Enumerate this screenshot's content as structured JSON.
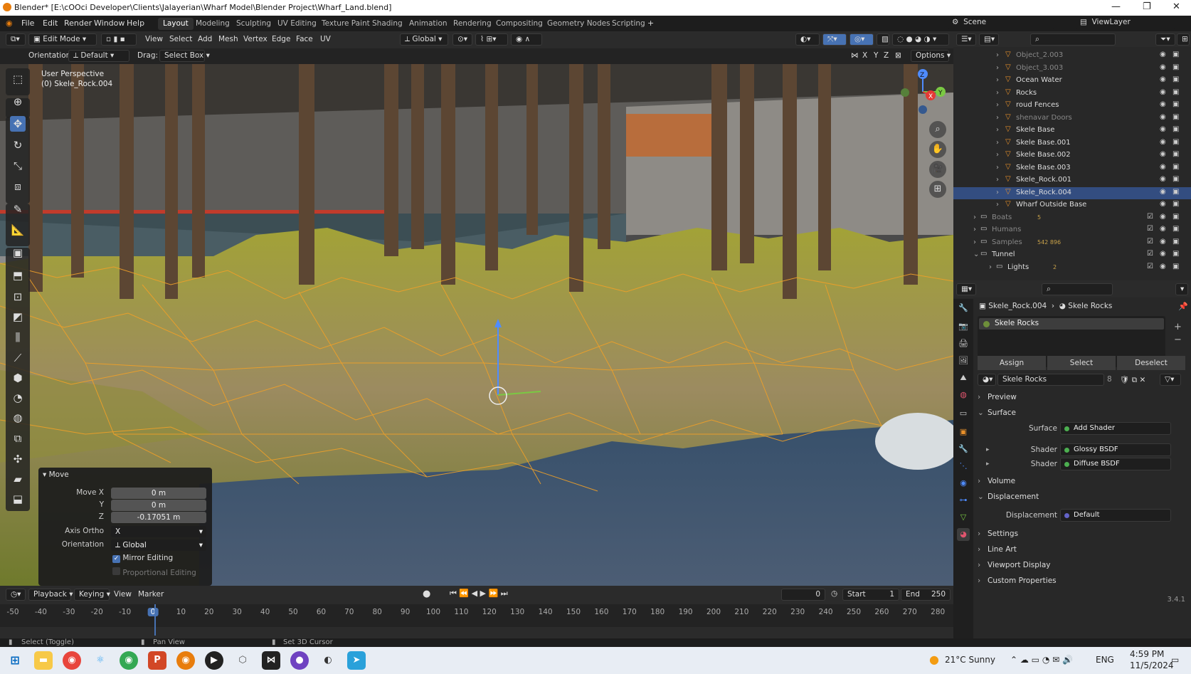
{
  "window": {
    "title": "Blender* [E:\\cOOci Developer\\Clients\\Jalayerian\\Wharf Model\\Blender Project\\Wharf_Land.blend]"
  },
  "menu": {
    "items": [
      "File",
      "Edit",
      "Render",
      "Window",
      "Help"
    ]
  },
  "workspaces": [
    "Layout",
    "Modeling",
    "Sculpting",
    "UV Editing",
    "Texture Paint",
    "Shading",
    "Animation",
    "Rendering",
    "Compositing",
    "Geometry Nodes",
    "Scripting"
  ],
  "scene": {
    "name": "Scene",
    "view_layer": "ViewLayer"
  },
  "header": {
    "mode": "Edit Mode",
    "menus": [
      "View",
      "Select",
      "Add",
      "Mesh",
      "Vertex",
      "Edge",
      "Face",
      "UV"
    ],
    "transform_orientation": "Global",
    "axis_labels": [
      "X",
      "Y",
      "Z"
    ],
    "options": "Options"
  },
  "tool_settings": {
    "orientation_label": "Orientation:",
    "orientation_value": "Default",
    "drag_label": "Drag:",
    "drag_value": "Select Box"
  },
  "viewport": {
    "view_name": "User Perspective",
    "object_info": "(0) Skele_Rock.004",
    "gizmo_axes": {
      "z": "Z",
      "y": "Y",
      "x": "X"
    }
  },
  "operator": {
    "title": "Move",
    "move_x_label": "Move X",
    "move_x": "0 m",
    "y_label": "Y",
    "y": "0 m",
    "z_label": "Z",
    "z": "-0.17051 m",
    "axis_ortho_label": "Axis Ortho",
    "axis_ortho": "X",
    "orientation_label": "Orientation",
    "orientation": "Global",
    "mirror_editing": "Mirror Editing",
    "proportional_editing": "Proportional Editing"
  },
  "timeline": {
    "menus": [
      "Playback",
      "Keying",
      "View",
      "Marker"
    ],
    "current_frame": "0",
    "start_label": "Start",
    "start": "1",
    "end_label": "End",
    "end": "250",
    "ticks": [
      "-50",
      "-40",
      "-30",
      "-20",
      "-10",
      "0",
      "10",
      "20",
      "30",
      "40",
      "50",
      "60",
      "70",
      "80",
      "90",
      "100",
      "110",
      "120",
      "130",
      "140",
      "150",
      "160",
      "170",
      "180",
      "190",
      "200",
      "210",
      "220",
      "230",
      "240",
      "250",
      "260",
      "270",
      "280"
    ]
  },
  "statusbar": {
    "select": "Select (Toggle)",
    "pan": "Pan View",
    "cursor": "Set 3D Cursor",
    "version": "3.4.1"
  },
  "outliner": {
    "rows": [
      {
        "name": "Object_2.003",
        "dim": true
      },
      {
        "name": "Object_3.003",
        "dim": true
      },
      {
        "name": "Ocean Water",
        "dim": false
      },
      {
        "name": "Rocks",
        "dim": false
      },
      {
        "name": "roud Fences",
        "dim": false
      },
      {
        "name": "shenavar Doors",
        "dim": true
      },
      {
        "name": "Skele Base",
        "dim": false
      },
      {
        "name": "Skele Base.001",
        "dim": false
      },
      {
        "name": "Skele Base.002",
        "dim": false
      },
      {
        "name": "Skele Base.003",
        "dim": false
      },
      {
        "name": "Skele_Rock.001",
        "dim": false
      },
      {
        "name": "Skele_Rock.004",
        "dim": false
      },
      {
        "name": "Wharf Outside Base",
        "dim": false
      }
    ],
    "collections": [
      {
        "name": "Boats",
        "badge": "5"
      },
      {
        "name": "Humans",
        "badge": ""
      },
      {
        "name": "Samples",
        "badge": "542 896"
      },
      {
        "name": "Tunnel",
        "badge": ""
      },
      {
        "name": "Lights",
        "badge": "2"
      }
    ]
  },
  "properties": {
    "breadcrumb_object": "Skele_Rock.004",
    "breadcrumb_material": "Skele Rocks",
    "slot": "Skele Rocks",
    "assign": "Assign",
    "select": "Select",
    "deselect": "Deselect",
    "material_name": "Skele Rocks",
    "users": "8",
    "sections": {
      "preview": "Preview",
      "surface": "Surface",
      "volume": "Volume",
      "displacement": "Displacement",
      "settings": "Settings",
      "line_art": "Line Art",
      "viewport_display": "Viewport Display",
      "custom_properties": "Custom Properties"
    },
    "surface_label": "Surface",
    "surface_value": "Add Shader",
    "shader_label": "Shader",
    "shader1": "Glossy BSDF",
    "shader2": "Diffuse BSDF",
    "displacement_label": "Displacement",
    "displacement_value": "Default"
  },
  "taskbar": {
    "weather": "21°C Sunny",
    "lang": "ENG",
    "time": "4:59 PM",
    "date": "11/5/2024"
  }
}
